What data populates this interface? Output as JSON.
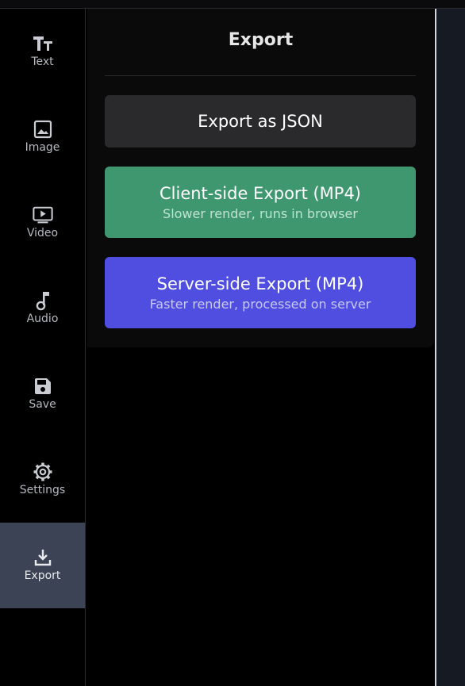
{
  "sidebar": {
    "items": [
      {
        "label": "Text",
        "icon": "text-icon"
      },
      {
        "label": "Image",
        "icon": "image-icon"
      },
      {
        "label": "Video",
        "icon": "video-icon"
      },
      {
        "label": "Audio",
        "icon": "music-note-icon"
      },
      {
        "label": "Save",
        "icon": "save-icon"
      },
      {
        "label": "Settings",
        "icon": "gear-icon"
      },
      {
        "label": "Export",
        "icon": "download-icon",
        "active": true
      }
    ]
  },
  "panel": {
    "title": "Export",
    "json_button": {
      "label": "Export as JSON"
    },
    "client_button": {
      "label": "Client-side Export (MP4)",
      "sublabel": "Slower render, runs in browser",
      "color": "#3f9770"
    },
    "server_button": {
      "label": "Server-side Export (MP4)",
      "sublabel": "Faster render, processed on server",
      "color": "#4f4ee0"
    }
  },
  "colors": {
    "active_nav": "#3b4354",
    "background": "#000000"
  }
}
